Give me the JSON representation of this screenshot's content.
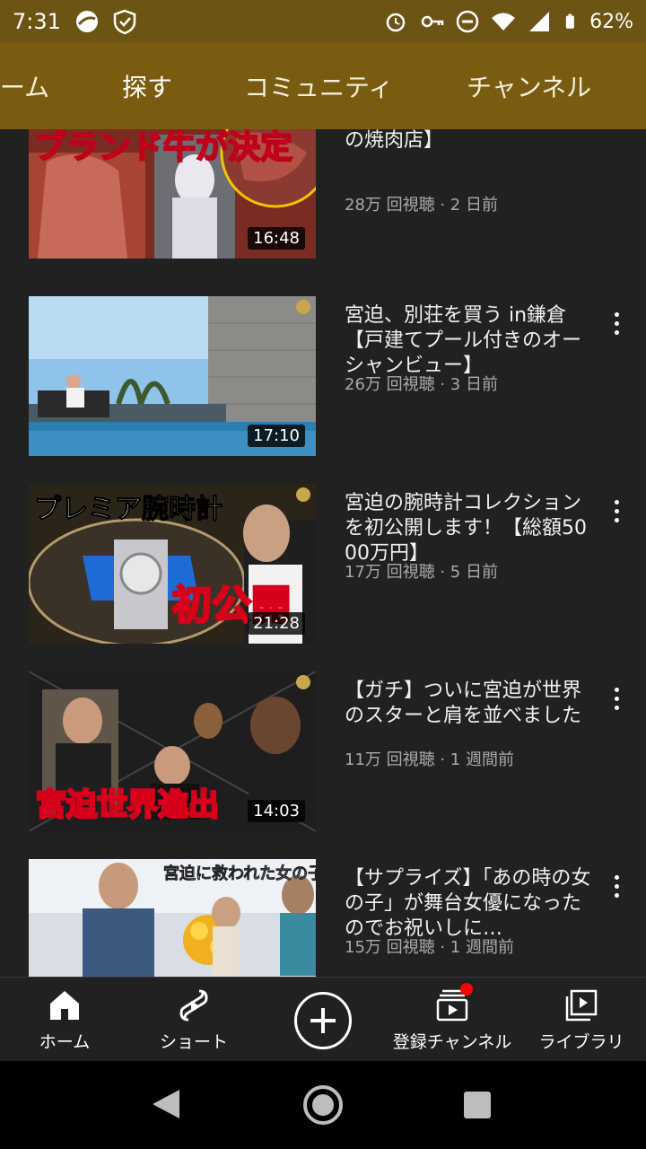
{
  "status_bar": {
    "time": "7:31",
    "battery": "62%",
    "icons": [
      "browser-icon",
      "shield-icon",
      "alarm-icon",
      "key-icon",
      "dnd-icon",
      "wifi-icon",
      "signal-icon",
      "battery-icon"
    ]
  },
  "tabs": [
    {
      "label": "ーム"
    },
    {
      "label": "探す"
    },
    {
      "label": "コミュニティ"
    },
    {
      "label": "チャンネル"
    }
  ],
  "videos": [
    {
      "title": "牛が決まりました【日本一の焼肉店】",
      "meta": "28万 回視聴 · 2 日前",
      "duration": "16:48",
      "thumb_text": "ブランド牛が決定"
    },
    {
      "title": "宮迫、別荘を買う in鎌倉【戸建てプール付きのオーシャンビュー】",
      "meta": "26万 回視聴 · 3 日前",
      "duration": "17:10",
      "thumb_text": ""
    },
    {
      "title": "宮迫の腕時計コレクションを初公開します！【総額5000万円】",
      "meta": "17万 回視聴 · 5 日前",
      "duration": "21:28",
      "thumb_text": "プレミア腕時計",
      "thumb_text2": "初公開"
    },
    {
      "title": "【ガチ】ついに宮迫が世界のスターと肩を並べました",
      "meta": "11万 回視聴 · 1 週間前",
      "duration": "14:03",
      "thumb_text": "宮迫世界進出"
    },
    {
      "title": "【サプライズ】「あの時の女の子」が舞台女優になったのでお祝いしに…",
      "meta": "15万 回視聴 · 1 週間前",
      "duration": "",
      "thumb_text": "宮迫に救われた女の子"
    }
  ],
  "bottom_nav": {
    "home": "ホーム",
    "shorts": "ショート",
    "subscriptions": "登録チャンネル",
    "library": "ライブラリ"
  },
  "colors": {
    "header_bg": "#7a5c10",
    "status_bg": "#6b5414",
    "feed_bg": "#212121",
    "notification_dot": "#ff0000"
  }
}
